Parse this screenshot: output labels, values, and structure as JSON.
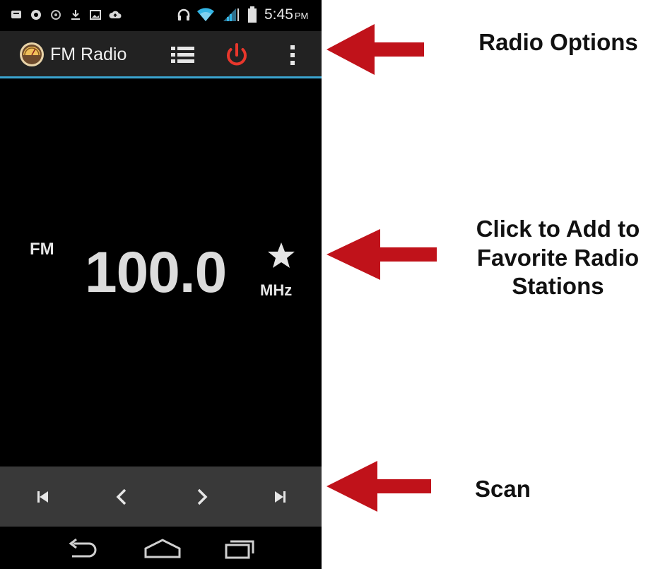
{
  "status_bar": {
    "time": "5:45",
    "ampm": "PM",
    "icons": [
      "message-icon",
      "chat-icon",
      "sync-icon",
      "download-icon",
      "image-icon",
      "cloud-icon",
      "headset-icon",
      "wifi-icon",
      "signal-icon",
      "battery-icon"
    ]
  },
  "action_bar": {
    "title": "FM Radio",
    "icons": [
      "radio-dial-icon",
      "station-list-icon",
      "power-icon",
      "overflow-menu-icon"
    ],
    "accent_color": "#3aa5d0",
    "power_color": "#e8372c"
  },
  "tuner": {
    "band": "FM",
    "frequency": "100.0",
    "unit": "MHz",
    "favorite_icon": "star-icon"
  },
  "controls": {
    "icons": [
      "skip-previous-icon",
      "seek-previous-icon",
      "seek-next-icon",
      "skip-next-icon"
    ]
  },
  "nav_bar": {
    "icons": [
      "back-icon",
      "home-icon",
      "recent-apps-icon"
    ]
  },
  "annotations": {
    "radio_options": "Radio Options",
    "favorite_lines": [
      "Click to Add to",
      "Favorite Radio",
      "Stations"
    ],
    "scan": "Scan",
    "arrow_color": "#c0121a"
  }
}
